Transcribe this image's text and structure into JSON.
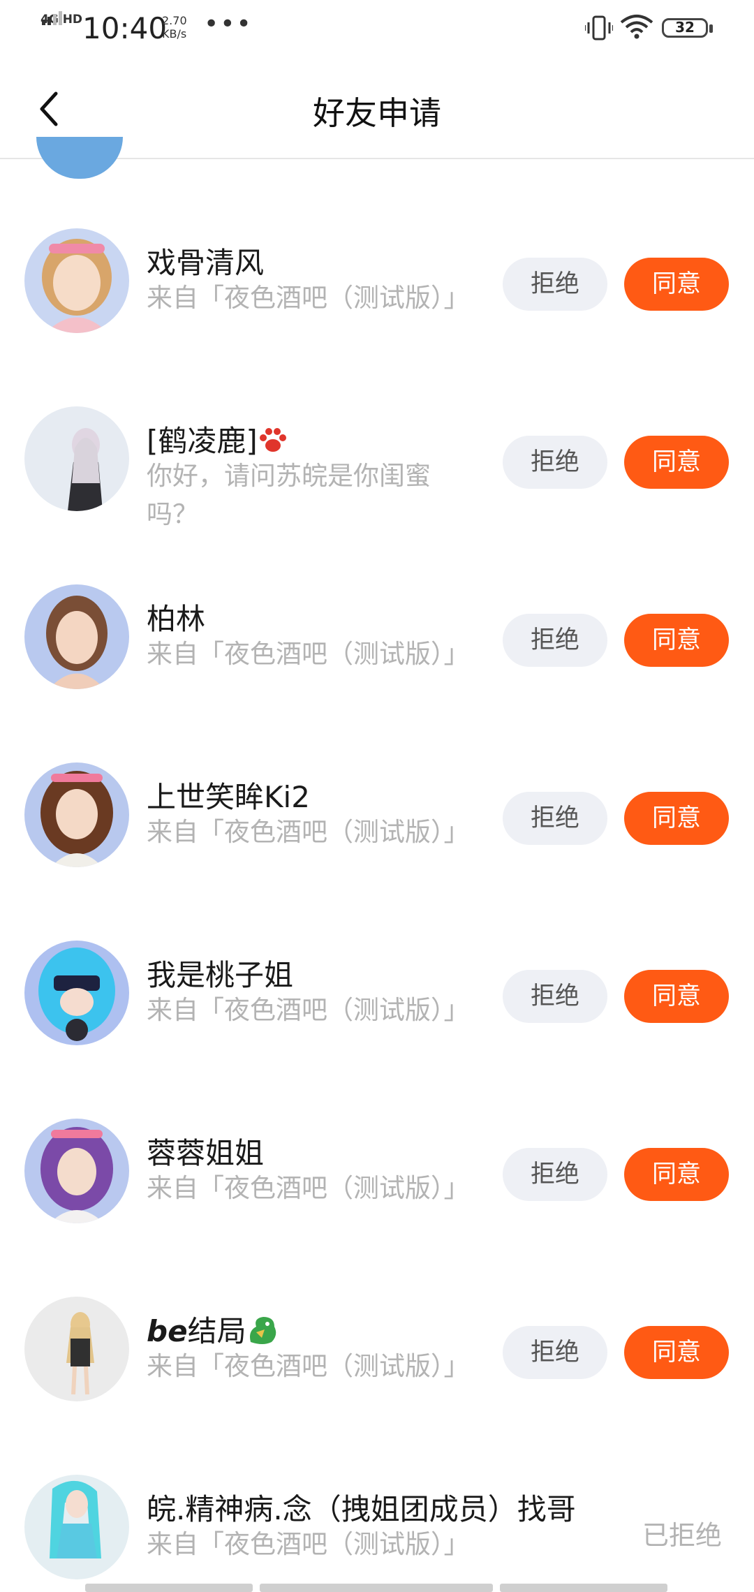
{
  "status_bar": {
    "network": "4G HD",
    "time": "10:40",
    "speed_value": "2.70",
    "speed_unit": "KB/s",
    "more": "•••",
    "battery": "32"
  },
  "header": {
    "title": "好友申请"
  },
  "requests": [
    {
      "name": "戏骨清风",
      "message": "来自「夜色酒吧（测试版）」",
      "reject_label": "拒绝",
      "accept_label": "同意",
      "avatar_color": "#c9d6f2"
    },
    {
      "name": "[鹤凌鹿]",
      "message": "你好，请问苏皖是你闺蜜吗？",
      "reject_label": "拒绝",
      "accept_label": "同意",
      "avatar_color": "#e6ebf2",
      "suffix_icon": "paw-icon"
    },
    {
      "name": "柏林",
      "message": "来自「夜色酒吧（测试版）」",
      "reject_label": "拒绝",
      "accept_label": "同意",
      "avatar_color": "#b9c9ef"
    },
    {
      "name": "上世笑眸Ki2",
      "message": "来自「夜色酒吧（测试版）」",
      "reject_label": "拒绝",
      "accept_label": "同意",
      "avatar_color": "#b8c8ee"
    },
    {
      "name": "我是桃子姐",
      "message": "来自「夜色酒吧（测试版）」",
      "reject_label": "拒绝",
      "accept_label": "同意",
      "avatar_color": "#aec0f0"
    },
    {
      "name": "蓉蓉姐姐",
      "message": "来自「夜色酒吧（测试版）」",
      "reject_label": "拒绝",
      "accept_label": "同意",
      "avatar_color": "#b9c8ef"
    },
    {
      "name_bold": "be",
      "name": "结局",
      "message": "来自「夜色酒吧（测试版）」",
      "reject_label": "拒绝",
      "accept_label": "同意",
      "avatar_color": "#ebebeb",
      "suffix_icon": "dragon-icon"
    },
    {
      "name": "皖.精神病.念（拽姐团成员）找哥",
      "message": "来自「夜色酒吧（测试版）」",
      "status": "已拒绝",
      "avatar_color": "#e4eef2"
    }
  ],
  "colors": {
    "accept": "#ff5a14",
    "reject_bg": "#eef0f5",
    "secondary_text": "#b3b3b3"
  }
}
